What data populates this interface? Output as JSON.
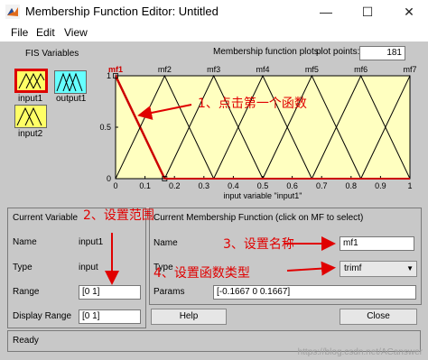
{
  "window": {
    "title": "Membership Function Editor: Untitled",
    "minimize": "—",
    "maximize": "☐",
    "close": "✕"
  },
  "menu": [
    "File",
    "Edit",
    "View"
  ],
  "fis": {
    "heading": "FIS Variables",
    "vars": [
      {
        "label": "input1",
        "color": "#ffff66",
        "selected": true
      },
      {
        "label": "output1",
        "color": "#66ffff",
        "selected": false
      },
      {
        "label": "input2",
        "color": "#ffff66",
        "selected": false
      }
    ]
  },
  "plot": {
    "heading": "Membership function plots",
    "points_label": "plot points:",
    "points_value": "181",
    "mf_labels": [
      "mf1",
      "mf2",
      "mf3",
      "mf4",
      "mf5",
      "mf6",
      "mf7"
    ],
    "yticks": [
      "1",
      "0.5",
      "0"
    ],
    "xticks": [
      "0",
      "0.1",
      "0.2",
      "0.3",
      "0.4",
      "0.5",
      "0.6",
      "0.7",
      "0.8",
      "0.9",
      "1"
    ],
    "xlabel": "input variable \"input1\"",
    "xrange": [
      0,
      1
    ],
    "yrange": [
      0,
      1
    ],
    "bg_color": "#ffffc0",
    "selected_color": "#cc0000"
  },
  "chart_data": {
    "type": "line",
    "xlabel": "input variable \"input1\"",
    "xlim": [
      0,
      1
    ],
    "ylim": [
      0,
      1
    ],
    "series": [
      {
        "name": "mf1",
        "values": [
          [
            -0.1667,
            0
          ],
          [
            0,
            1
          ],
          [
            0.1667,
            0
          ]
        ]
      },
      {
        "name": "mf2",
        "values": [
          [
            0,
            0
          ],
          [
            0.1667,
            1
          ],
          [
            0.3333,
            0
          ]
        ]
      },
      {
        "name": "mf3",
        "values": [
          [
            0.1667,
            0
          ],
          [
            0.3333,
            1
          ],
          [
            0.5,
            0
          ]
        ]
      },
      {
        "name": "mf4",
        "values": [
          [
            0.3333,
            0
          ],
          [
            0.5,
            1
          ],
          [
            0.6667,
            0
          ]
        ]
      },
      {
        "name": "mf5",
        "values": [
          [
            0.5,
            0
          ],
          [
            0.6667,
            1
          ],
          [
            0.8333,
            0
          ]
        ]
      },
      {
        "name": "mf6",
        "values": [
          [
            0.6667,
            0
          ],
          [
            0.8333,
            1
          ],
          [
            1,
            0
          ]
        ]
      },
      {
        "name": "mf7",
        "values": [
          [
            0.8333,
            0
          ],
          [
            1,
            1
          ],
          [
            1.1667,
            0
          ]
        ]
      }
    ]
  },
  "current_variable": {
    "heading": "Current Variable",
    "name_label": "Name",
    "name_value": "input1",
    "type_label": "Type",
    "type_value": "input",
    "range_label": "Range",
    "range_value": "[0 1]",
    "display_range_label": "Display Range",
    "display_range_value": "[0 1]"
  },
  "current_mf": {
    "heading": "Current Membership Function (click on MF to select)",
    "name_label": "Name",
    "name_value": "mf1",
    "type_label": "Type",
    "type_value": "trimf",
    "params_label": "Params",
    "params_value": "[-0.1667 0 0.1667]"
  },
  "buttons": {
    "help": "Help",
    "close": "Close"
  },
  "status": "Ready",
  "annotations": {
    "a1": "1、点击第一个函数",
    "a2": "2、设置范围",
    "a3": "3、设置名称",
    "a4": "4、设置函数类型"
  },
  "watermark": "https://blog.csdn.net/ACanswer"
}
